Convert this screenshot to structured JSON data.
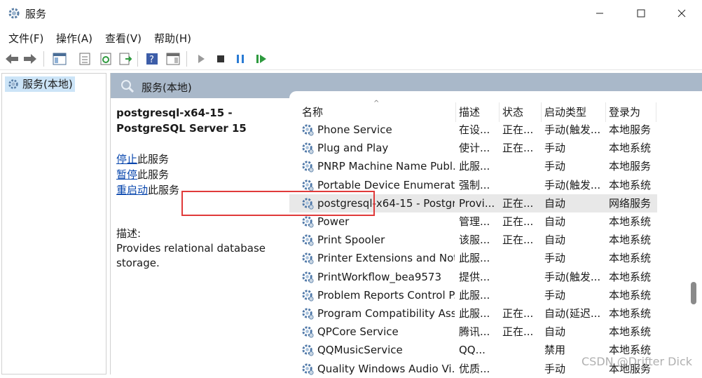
{
  "window": {
    "title": "服务"
  },
  "menu": [
    "文件(F)",
    "操作(A)",
    "查看(V)",
    "帮助(H)"
  ],
  "tree": {
    "root": "服务(本地)"
  },
  "main": {
    "header": "服务(本地)"
  },
  "detail": {
    "service_title": "postgresql-x64-15 - PostgreSQL Server 15",
    "actions": [
      {
        "link": "停止",
        "suffix": "此服务"
      },
      {
        "link": "暂停",
        "suffix": "此服务"
      },
      {
        "link": "重启动",
        "suffix": "此服务"
      }
    ],
    "desc_label": "描述:",
    "desc_text": "Provides relational database storage."
  },
  "columns": [
    "名称",
    "描述",
    "状态",
    "启动类型",
    "登录为"
  ],
  "services": [
    {
      "name": "Phone Service",
      "desc": "在设...",
      "status": "正在...",
      "startup": "手动(触发...",
      "logon": "本地服务"
    },
    {
      "name": "Plug and Play",
      "desc": "使计...",
      "status": "正在...",
      "startup": "手动",
      "logon": "本地系统"
    },
    {
      "name": "PNRP Machine Name Publ...",
      "desc": "此服...",
      "status": "",
      "startup": "手动",
      "logon": "本地服务"
    },
    {
      "name": "Portable Device Enumerat...",
      "desc": "强制...",
      "status": "",
      "startup": "手动(触发...",
      "logon": "本地系统"
    },
    {
      "name": "postgresql-x64-15 - Postgr...",
      "desc": "Provi...",
      "status": "正在...",
      "startup": "自动",
      "logon": "网络服务"
    },
    {
      "name": "Power",
      "desc": "管理...",
      "status": "正在...",
      "startup": "自动",
      "logon": "本地系统"
    },
    {
      "name": "Print Spooler",
      "desc": "该服...",
      "status": "正在...",
      "startup": "自动",
      "logon": "本地系统"
    },
    {
      "name": "Printer Extensions and Noti...",
      "desc": "此服...",
      "status": "",
      "startup": "手动",
      "logon": "本地系统"
    },
    {
      "name": "PrintWorkflow_bea9573",
      "desc": "提供...",
      "status": "",
      "startup": "手动(触发...",
      "logon": "本地系统"
    },
    {
      "name": "Problem Reports Control P...",
      "desc": "此服...",
      "status": "",
      "startup": "手动",
      "logon": "本地系统"
    },
    {
      "name": "Program Compatibility Assi...",
      "desc": "此服...",
      "status": "正在...",
      "startup": "自动(延迟...",
      "logon": "本地系统"
    },
    {
      "name": "QPCore Service",
      "desc": "腾讯...",
      "status": "正在...",
      "startup": "自动",
      "logon": "本地系统"
    },
    {
      "name": "QQMusicService",
      "desc": "QQ...",
      "status": "",
      "startup": "禁用",
      "logon": "本地系统"
    },
    {
      "name": "Quality Windows Audio Vi...",
      "desc": "优质...",
      "status": "",
      "startup": "手动",
      "logon": "本地服务"
    }
  ],
  "watermark": "CSDN @Drifter Dick",
  "colors": {
    "header_bar": "#a9b8c9",
    "selection": "#cce4f7",
    "highlight": "#e03a3a",
    "link": "#0645ad"
  }
}
